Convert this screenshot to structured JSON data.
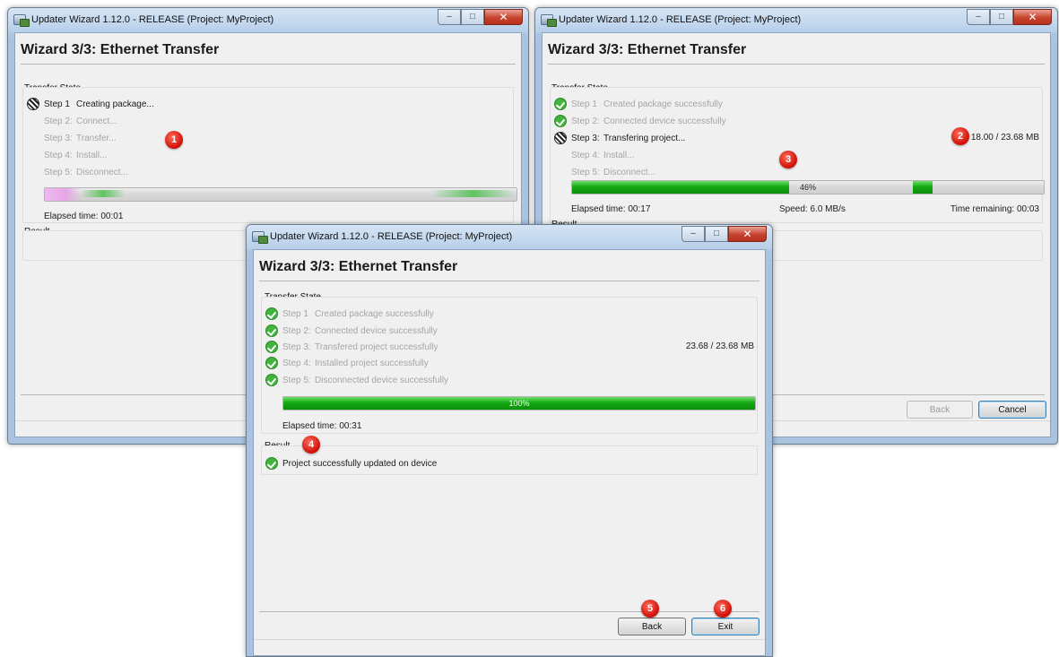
{
  "window_title": "Updater Wizard 1.12.0 - RELEASE (Project: MyProject)",
  "heading": "Wizard 3/3:   Ethernet Transfer",
  "transfer_state_label": "Transfer State",
  "result_label": "Result",
  "window_controls": {
    "minimize": "–",
    "maximize": "□",
    "close": "✕"
  },
  "colors": {
    "success_green": "#42b43d",
    "progress_green": "#15a814",
    "badge_red": "#d2140b"
  },
  "win1": {
    "steps": [
      {
        "num": "Step 1",
        "text": "Creating package...",
        "state": "busy"
      },
      {
        "num": "Step 2:",
        "text": "Connect...",
        "state": "pending"
      },
      {
        "num": "Step 3:",
        "text": "Transfer...",
        "state": "pending"
      },
      {
        "num": "Step 4:",
        "text": "Install...",
        "state": "pending"
      },
      {
        "num": "Step 5:",
        "text": "Disconnect...",
        "state": "pending"
      }
    ],
    "elapsed": "Elapsed time: 00:01",
    "badge": "1"
  },
  "win2": {
    "steps": [
      {
        "num": "Step 1",
        "text": "Created package successfully",
        "state": "done"
      },
      {
        "num": "Step 2:",
        "text": "Connected device successfully",
        "state": "done"
      },
      {
        "num": "Step 3:",
        "text": "Transfering project...",
        "state": "busy"
      },
      {
        "num": "Step 4:",
        "text": "Install...",
        "state": "pending"
      },
      {
        "num": "Step 5:",
        "text": "Disconnect...",
        "state": "pending"
      }
    ],
    "size": "18.00 / 23.68 MB",
    "progress_text": "46%",
    "progress": 0.46,
    "elapsed": "Elapsed time: 00:17",
    "speed": "Speed: 6.0 MB/s",
    "remaining": "Time remaining: 00:03",
    "back_button": "Back",
    "cancel_button": "Cancel",
    "badges": [
      "2",
      "3"
    ]
  },
  "win3": {
    "steps": [
      {
        "num": "Step 1",
        "text": "Created package successfully",
        "state": "done"
      },
      {
        "num": "Step 2:",
        "text": "Connected device successfully",
        "state": "done"
      },
      {
        "num": "Step 3:",
        "text": "Transfered project successfully",
        "state": "done"
      },
      {
        "num": "Step 4:",
        "text": "Installed project successfully",
        "state": "done"
      },
      {
        "num": "Step 5:",
        "text": "Disconnected device successfully",
        "state": "done"
      }
    ],
    "size": "23.68 / 23.68 MB",
    "progress_text": "100%",
    "progress": 1.0,
    "elapsed": "Elapsed time: 00:31",
    "result_text": "Project successfully updated on device",
    "back_button": "Back",
    "exit_button": "Exit",
    "badges": [
      "4",
      "5",
      "6"
    ]
  }
}
